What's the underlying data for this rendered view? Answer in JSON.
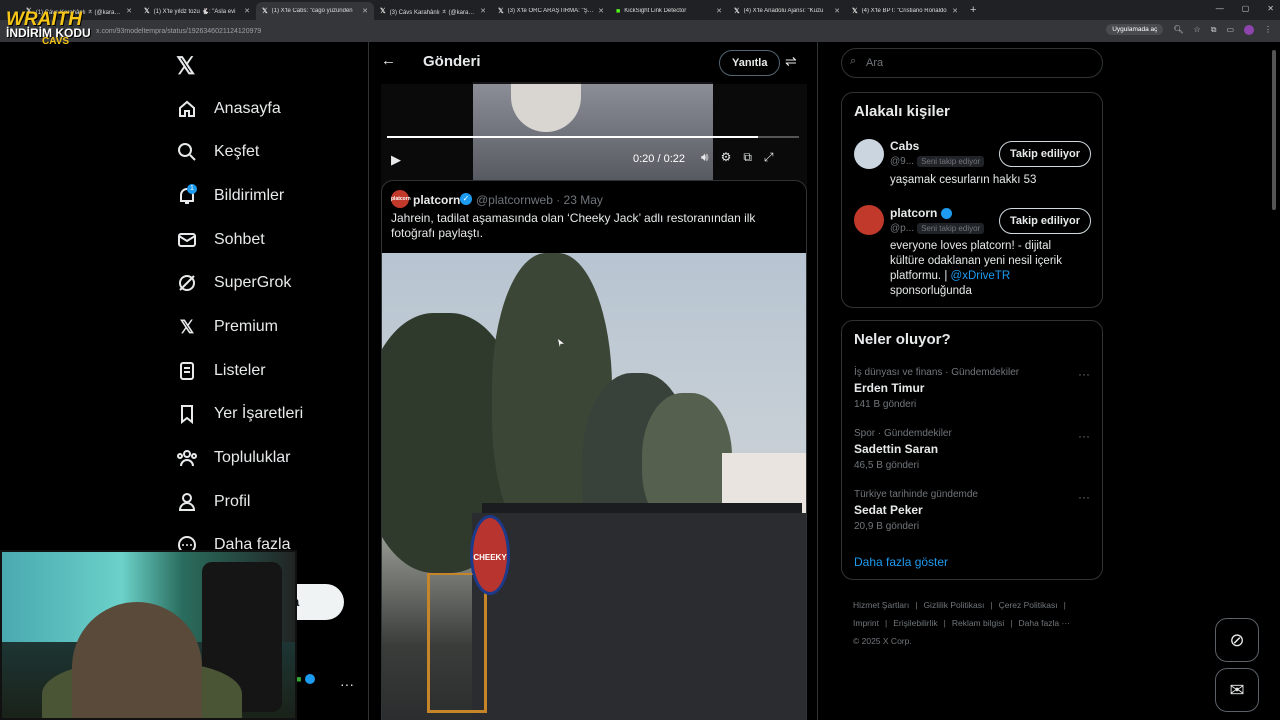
{
  "browser": {
    "tabs": [
      {
        "label": "(1) Cávs Karahânlı ㅊ (@karahan",
        "active": false
      },
      {
        "label": "(1) X'te yıldz tozu 🐇: \"Asla evi",
        "active": false
      },
      {
        "label": "(1) X'te Cabs: \"cago yüzünden",
        "active": true
      },
      {
        "label": "(3) Cávs Karahânlı ㅊ (@karahan",
        "active": false
      },
      {
        "label": "(3) X'te ORC ARAŞTIRMA: \"ŞİVA",
        "active": false
      },
      {
        "label": "KickSight Link Detector",
        "active": false
      },
      {
        "label": "(4) X'te Anadolu Ajansı: \"Kuzu",
        "active": false
      },
      {
        "label": "(4) X'te BPT: \"Cristiano Ronaldo",
        "active": false
      }
    ],
    "url": "x.com/93modeltempra/status/1926346021124120979",
    "app_pill": "Uygulamada aç"
  },
  "overlay_logo": {
    "line1": "WRAITH",
    "line2": "İNDİRİM KODU",
    "line3": "CAVS"
  },
  "nav": {
    "items": [
      {
        "label": "Anasayfa",
        "icon": "home-icon"
      },
      {
        "label": "Keşfet",
        "icon": "search-icon"
      },
      {
        "label": "Bildirimler",
        "icon": "bell-icon"
      },
      {
        "label": "Sohbet",
        "icon": "mail-icon"
      },
      {
        "label": "SuperGrok",
        "icon": "grok-icon"
      },
      {
        "label": "Premium",
        "icon": "x-icon"
      },
      {
        "label": "Listeler",
        "icon": "list-icon"
      },
      {
        "label": "Yer İşaretleri",
        "icon": "bookmark-icon"
      },
      {
        "label": "Topluluklar",
        "icon": "community-icon"
      },
      {
        "label": "Profil",
        "icon": "profile-icon"
      },
      {
        "label": "Daha fazla",
        "icon": "more-icon"
      }
    ],
    "notif_count": "1",
    "post_button": "a"
  },
  "header": {
    "title": "Gönderi",
    "reply_button": "Yanıtla"
  },
  "video": {
    "time": "0:20 / 0:22",
    "progress": 0.9
  },
  "quoted_tweet": {
    "avatar_text": "platcorn",
    "name": "platcorn",
    "verified": "✓",
    "handle_date": "@platcornweb · 23 May",
    "text": "Jahrein, tadilat aşamasında olan ‘Cheeky Jack’ adlı restoranından ilk fotoğrafı paylaştı.",
    "sign_text": "CHEEKY"
  },
  "search": {
    "placeholder": "Ara"
  },
  "related": {
    "title": "Alakalı kişiler",
    "people": [
      {
        "name": "Cabs",
        "handle": "@9...",
        "badge": "Seni takip ediyor",
        "button": "Takip ediliyor",
        "bio": "yaşamak cesurların hakkı 53",
        "verified": false
      },
      {
        "name": "platcorn",
        "handle": "@p...",
        "badge": "Seni takip ediyor",
        "button": "Takip ediliyor",
        "bio_pre": "everyone loves platcorn! - dijital kültüre odaklanan yeni nesil içerik platformu. |",
        "bio_link": "@xDriveTR",
        "bio_post": "sponsorluğunda",
        "verified": true
      }
    ]
  },
  "trends": {
    "title": "Neler oluyor?",
    "items": [
      {
        "meta": "İş dünyası ve finans · Gündemdekiler",
        "title": "Erden Timur",
        "count": "141 B gönderi"
      },
      {
        "meta": "Spor · Gündemdekiler",
        "title": "Sadettin Saran",
        "count": "46,5 B gönderi"
      },
      {
        "meta": "Türkiye tarihinde gündemde",
        "title": "Sedat Peker",
        "count": "20,9 B gönderi"
      }
    ],
    "show_more": "Daha fazla göster"
  },
  "footer": {
    "links": [
      "Hizmet Şartları",
      "|",
      "Gizlilik Politikası",
      "|",
      "Çerez Politikası",
      "|",
      "Imprint",
      "|",
      "Erişilebilirlik",
      "|",
      "Reklam bilgisi",
      "|",
      "Daha fazla ···"
    ],
    "copyright": "© 2025 X Corp."
  },
  "colors": {
    "accent": "#1d9bf0",
    "bg": "#000000",
    "border": "#2f3336",
    "muted": "#71767b"
  }
}
